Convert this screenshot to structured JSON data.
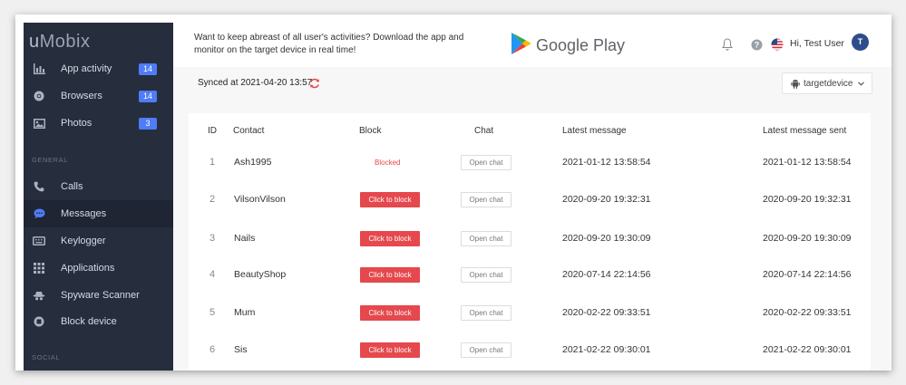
{
  "app": {
    "logo_u": "u",
    "logo_rest": "Mobix"
  },
  "sidebar": {
    "items_top": [
      {
        "label": "App activity",
        "badge": "14"
      },
      {
        "label": "Browsers",
        "badge": "14"
      },
      {
        "label": "Photos",
        "badge": "3"
      }
    ],
    "section_general": "GENERAL",
    "items_general": [
      {
        "label": "Calls"
      },
      {
        "label": "Messages"
      },
      {
        "label": "Keylogger"
      },
      {
        "label": "Applications"
      },
      {
        "label": "Spyware Scanner"
      },
      {
        "label": "Block device"
      }
    ],
    "section_social": "SOCIAL",
    "active_item": "Messages"
  },
  "header": {
    "promo_text": "Want to keep abreast of all user's activities? Download the app and monitor on the target device in real time!",
    "store_label": "Google Play",
    "greeting": "Hi, Test User",
    "avatar_initial": "T"
  },
  "sync": {
    "label": "Synced at 2021-04-20 13:57"
  },
  "device_selector": {
    "value": "targetdevice"
  },
  "table": {
    "headers": {
      "id": "ID",
      "contact": "Contact",
      "block": "Block",
      "chat": "Chat",
      "latest": "Latest message",
      "sent": "Latest message sent"
    },
    "block_label": "Click to block",
    "blocked_label": "Blocked",
    "chat_label": "Open chat",
    "rows": [
      {
        "id": "1",
        "contact": "Ash1995",
        "blocked": true,
        "latest": "2021-01-12 13:58:54",
        "sent": "2021-01-12 13:58:54"
      },
      {
        "id": "2",
        "contact": "VilsonVilson",
        "blocked": false,
        "latest": "2020-09-20 19:32:31",
        "sent": "2020-09-20 19:32:31"
      },
      {
        "id": "3",
        "contact": "Nails",
        "blocked": false,
        "latest": "2020-09-20 19:30:09",
        "sent": "2020-09-20 19:30:09"
      },
      {
        "id": "4",
        "contact": "BeautyShop",
        "blocked": false,
        "latest": "2020-07-14 22:14:56",
        "sent": "2020-07-14 22:14:56"
      },
      {
        "id": "5",
        "contact": "Mum",
        "blocked": false,
        "latest": "2020-02-22 09:33:51",
        "sent": "2020-02-22 09:33:51"
      },
      {
        "id": "6",
        "contact": "Sis",
        "blocked": false,
        "latest": "2021-02-22 09:30:01",
        "sent": "2021-02-22 09:30:01"
      }
    ]
  },
  "colors": {
    "sidebar_bg": "#262d3d",
    "accent": "#4f7cf7",
    "danger": "#e5484d",
    "avatar": "#2d4d8a"
  }
}
